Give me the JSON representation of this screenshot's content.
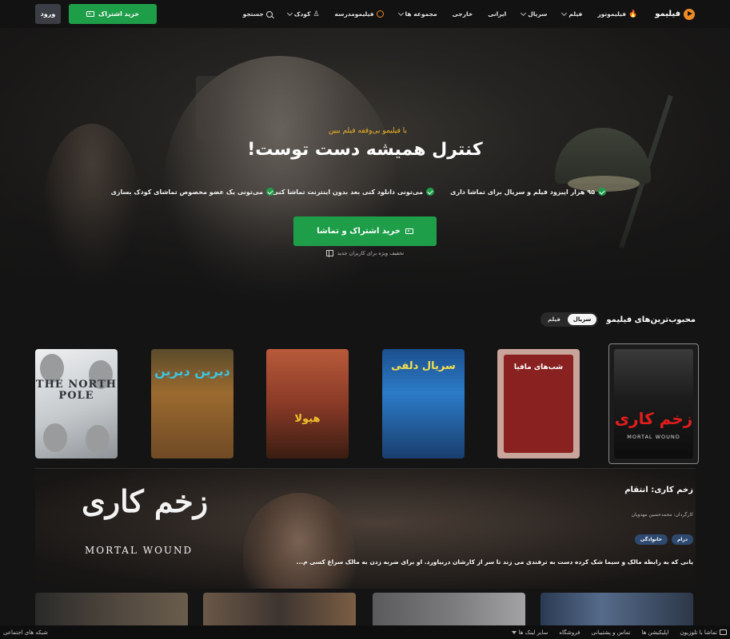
{
  "nav": {
    "brand": "فیلیمو",
    "items": [
      {
        "label": "فیلیموتور",
        "icon": "fire-icon",
        "dropdown": false
      },
      {
        "label": "فیلم",
        "dropdown": true
      },
      {
        "label": "سریال",
        "dropdown": true
      },
      {
        "label": "ایرانی",
        "dropdown": false
      },
      {
        "label": "خارجی",
        "dropdown": false
      },
      {
        "label": "مجموعه ها",
        "dropdown": true
      },
      {
        "label": "فیلیمومدرسه",
        "icon": "school-icon",
        "dropdown": false
      },
      {
        "label": "کودک",
        "icon": "kid-icon",
        "dropdown": true
      },
      {
        "label": "جستجو",
        "icon": "search-icon",
        "dropdown": false
      }
    ],
    "subscribe_label": "خرید اشتراک",
    "login_label": "ورود"
  },
  "hero": {
    "tagline": "با فیلیمو بی‌وقفه فیلم ببین",
    "title": "کنترل همیشه دست توست!",
    "features": [
      "۹۵ هزار اپیزود فیلم و سریال برای تماشا داری",
      "می‌تونی دانلود کنی بعد بدون اینترنت تماشا کنی",
      "می‌تونی یک عضو مخصوص تماشای کودک بسازی"
    ],
    "cta_label": "خرید اشتراک و تماشا",
    "note": "تخفیف ویژه برای کاربران جدید"
  },
  "popular": {
    "title": "محبوب‌ترین‌های فیلیمو",
    "toggle": {
      "series": "سریال",
      "film": "فیلم",
      "active": "series"
    },
    "posters": [
      {
        "title": "زخم کاری",
        "subtitle": "MORTAL WOUND"
      },
      {
        "title": "شب‌های مافیا"
      },
      {
        "title": "دیرین دیرین"
      },
      {
        "title": "هیولا"
      },
      {
        "title": "سریال دلفی"
      },
      {
        "title": "THE NORTH POLE"
      }
    ]
  },
  "featured": {
    "logo_title": "زخم کاری",
    "logo_subtitle": "MORTAL WOUND",
    "title": "زخم کاری: انتقام",
    "director": "کارگردان: محمدحسین مهدویان",
    "genres": [
      "درام",
      "خانوادگی"
    ],
    "description": "یانی که به رابطه مالک و سیما شک کرده دست به ترفندی می زند تا سر از کارشان دربیاورد. او برای ضربه زدن به مالک سراغ کسی م..."
  },
  "bottombar": {
    "items": [
      "تماشا با تلوزیون",
      "اپلیکیشن ها",
      "تماس و پشتیبانی",
      "فروشگاه",
      "سایر لینک ها"
    ],
    "social": "شبکه های اجتماعی"
  },
  "colors": {
    "accent": "#1f9e4a",
    "brand": "#f08a24",
    "tagline": "#f0b429",
    "genre_bg": "#2f4a70"
  }
}
